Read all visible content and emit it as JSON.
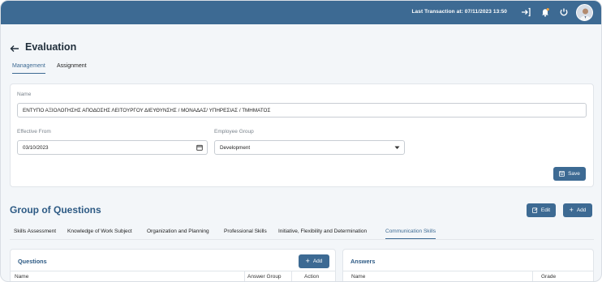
{
  "topbar": {
    "last_transaction": "Last Transaction at: 07/11/2023 13:50",
    "icons": [
      "logout-icon",
      "bell-icon",
      "power-icon",
      "user-avatar"
    ],
    "accent_color": "#3d6a93"
  },
  "page": {
    "title": "Evaluation"
  },
  "tabs": [
    {
      "label": "Management",
      "active": true
    },
    {
      "label": "Assignment",
      "active": false
    }
  ],
  "form": {
    "name_label": "Name",
    "name_value": "ΕΝΤΥΠΟ ΑΞΙΟΛΟΓΗΣΗΣ ΑΠΟΔΟΣΗΣ ΛΕΙΤΟΥΡΓΟΥ ΔΙΕΥΘΥΝΣΗΣ / ΜΟΝΑΔΑΣ/ ΥΠΗΡΕΣΙΑΣ / ΤΜΗΜΑΤΟΣ",
    "effective_from_label": "Effective From",
    "effective_from_value": "03/10/2023",
    "employee_group_label": "Employee Group",
    "employee_group_value": "Development",
    "save_label": "Save"
  },
  "group": {
    "title": "Group of Questions",
    "edit_label": "Edit",
    "add_label": "Add",
    "tabs": [
      {
        "label": "Skills Assessment",
        "active": false
      },
      {
        "label": "Knowledge of Work Subject",
        "active": false
      },
      {
        "label": "Organization and Planning",
        "active": false
      },
      {
        "label": "Professional Skills",
        "active": false
      },
      {
        "label": "Initiative, Flexibility and Determination",
        "active": false
      },
      {
        "label": "Communication Skills",
        "active": true
      }
    ]
  },
  "questions": {
    "title": "Questions",
    "add_label": "Add",
    "columns": [
      "Name",
      "Answer Group",
      "Action"
    ]
  },
  "answers": {
    "title": "Answers",
    "columns": [
      "Name",
      "Grade"
    ]
  }
}
